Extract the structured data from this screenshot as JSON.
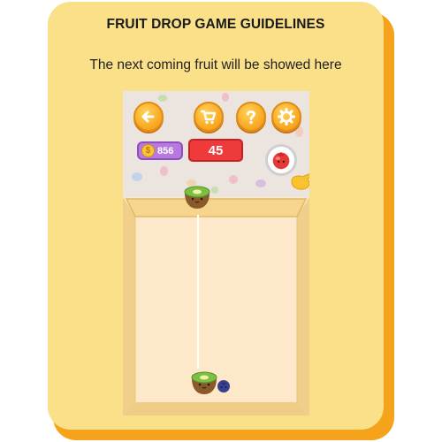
{
  "header": {
    "title": "FRUIT DROP GAME GUIDELINES",
    "subtitle": "The next coming fruit will be showed here"
  },
  "game": {
    "coins": "856",
    "coin_symbol": "$",
    "score": "45",
    "buttons": [
      {
        "name": "back-button",
        "icon": "arrow-left-icon"
      },
      {
        "name": "shop-button",
        "icon": "cart-icon"
      },
      {
        "name": "help-button",
        "icon": "question-icon"
      },
      {
        "name": "settings-button",
        "icon": "gear-icon"
      }
    ],
    "next_fruit": "pomegranate",
    "current_fruit": "kiwi",
    "bottom_fruits": [
      "kiwi",
      "blueberry"
    ]
  },
  "colors": {
    "card": "#fbe08a",
    "card_shadow": "#f5a31b",
    "button": "#f7a51f",
    "score_box": "#ee3a3a",
    "coin_box": "#b679de"
  }
}
